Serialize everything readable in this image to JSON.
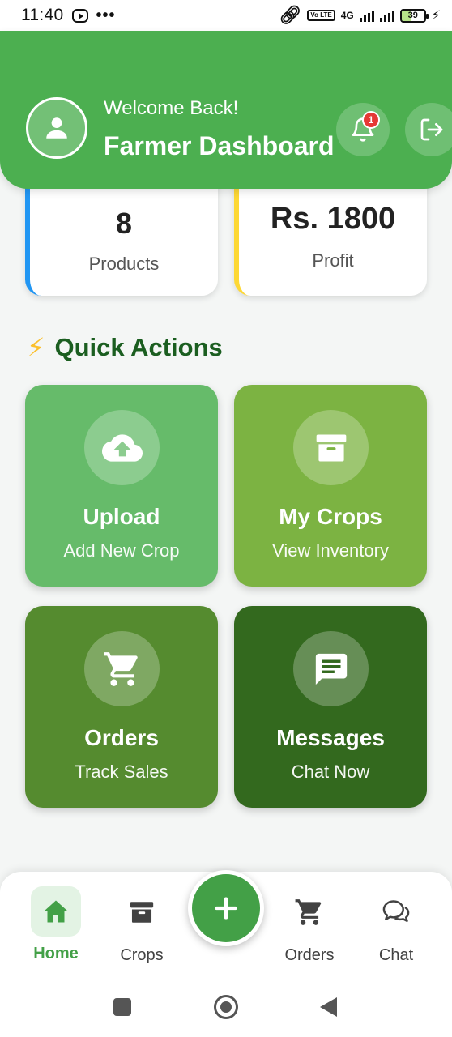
{
  "status_bar": {
    "time": "11:40",
    "dots": "•••",
    "network": "4G",
    "volte": "Vo LTE",
    "battery": "39"
  },
  "header": {
    "welcome": "Welcome Back!",
    "title": "Farmer Dashboard",
    "notification_count": "1",
    "colors": {
      "header_green": "#4caf50"
    }
  },
  "stats": {
    "products": {
      "value": "8",
      "label": "Products",
      "accent": "#2196f3"
    },
    "profit": {
      "value": "Rs. 1800",
      "label": "Profit",
      "accent": "#fdd835"
    }
  },
  "quick_actions": {
    "title": "Quick Actions",
    "icon": "⚡",
    "cards": [
      {
        "title": "Upload",
        "subtitle": "Add New Crop",
        "icon": "cloud-upload-icon",
        "color": "#66bb6a"
      },
      {
        "title": "My Crops",
        "subtitle": "View Inventory",
        "icon": "archive-box-icon",
        "color": "#7cb342"
      },
      {
        "title": "Orders",
        "subtitle": "Track Sales",
        "icon": "cart-icon",
        "color": "#558b2f"
      },
      {
        "title": "Messages",
        "subtitle": "Chat Now",
        "icon": "message-icon",
        "color": "#33691e"
      }
    ]
  },
  "bottom_nav": {
    "items": [
      {
        "label": "Home",
        "icon": "home-icon",
        "active": true
      },
      {
        "label": "Crops",
        "icon": "archive-box-icon"
      },
      {
        "label": "Orders",
        "icon": "cart-icon"
      },
      {
        "label": "Chat",
        "icon": "chat-bubbles-icon"
      }
    ],
    "fab_icon": "plus-icon"
  }
}
